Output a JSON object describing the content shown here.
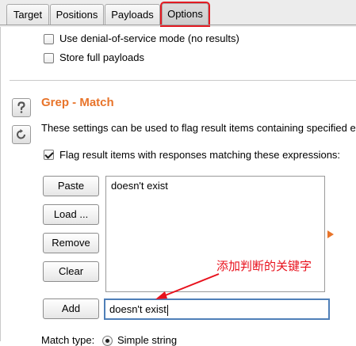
{
  "tabs": [
    {
      "label": "Target"
    },
    {
      "label": "Positions"
    },
    {
      "label": "Payloads"
    },
    {
      "label": "Options"
    }
  ],
  "options": {
    "dos_mode": {
      "label": "Use denial-of-service mode (no results)",
      "checked": false
    },
    "store_payloads": {
      "label": "Store full payloads",
      "checked": false
    }
  },
  "grep_match": {
    "title": "Grep - Match",
    "description": "These settings can be used to flag result items containing specified e",
    "flag_checkbox": {
      "label": "Flag result items with responses matching these expressions:",
      "checked": true
    },
    "buttons": {
      "paste": "Paste",
      "load": "Load ...",
      "remove": "Remove",
      "clear": "Clear",
      "add": "Add"
    },
    "list_items": [
      "doesn't exist"
    ],
    "add_input_value": "doesn't exist",
    "match_type_label": "Match type:",
    "match_type_option": "Simple string"
  },
  "annotation": {
    "text": "添加判断的关键字",
    "color": "#e8121d"
  },
  "colors": {
    "accent_orange": "#e8742a",
    "active_tab_outline": "#e21b23",
    "focus_blue": "#4f7fb8"
  },
  "icons": {
    "help": "help-icon",
    "reset": "reset-icon"
  }
}
